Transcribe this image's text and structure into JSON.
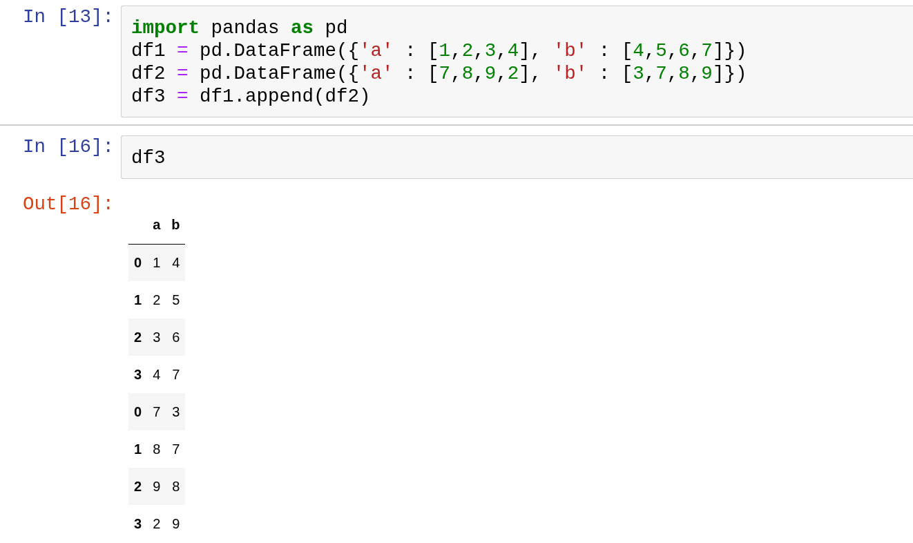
{
  "cells": [
    {
      "prompt": "In [13]:",
      "lines": [
        [
          {
            "text": "import",
            "kind": "keyword"
          },
          {
            "text": " pandas ",
            "kind": "plain"
          },
          {
            "text": "as",
            "kind": "keyword"
          },
          {
            "text": " pd",
            "kind": "plain"
          }
        ],
        [
          {
            "text": "df1 ",
            "kind": "plain"
          },
          {
            "text": "=",
            "kind": "operator"
          },
          {
            "text": " pd.DataFrame({",
            "kind": "plain"
          },
          {
            "text": "'a'",
            "kind": "string"
          },
          {
            "text": " : [",
            "kind": "plain"
          },
          {
            "text": "1",
            "kind": "number"
          },
          {
            "text": ",",
            "kind": "plain"
          },
          {
            "text": "2",
            "kind": "number"
          },
          {
            "text": ",",
            "kind": "plain"
          },
          {
            "text": "3",
            "kind": "number"
          },
          {
            "text": ",",
            "kind": "plain"
          },
          {
            "text": "4",
            "kind": "number"
          },
          {
            "text": "], ",
            "kind": "plain"
          },
          {
            "text": "'b'",
            "kind": "string"
          },
          {
            "text": " : [",
            "kind": "plain"
          },
          {
            "text": "4",
            "kind": "number"
          },
          {
            "text": ",",
            "kind": "plain"
          },
          {
            "text": "5",
            "kind": "number"
          },
          {
            "text": ",",
            "kind": "plain"
          },
          {
            "text": "6",
            "kind": "number"
          },
          {
            "text": ",",
            "kind": "plain"
          },
          {
            "text": "7",
            "kind": "number"
          },
          {
            "text": "]})",
            "kind": "plain"
          }
        ],
        [
          {
            "text": "df2 ",
            "kind": "plain"
          },
          {
            "text": "=",
            "kind": "operator"
          },
          {
            "text": " pd.DataFrame({",
            "kind": "plain"
          },
          {
            "text": "'a'",
            "kind": "string"
          },
          {
            "text": " : [",
            "kind": "plain"
          },
          {
            "text": "7",
            "kind": "number"
          },
          {
            "text": ",",
            "kind": "plain"
          },
          {
            "text": "8",
            "kind": "number"
          },
          {
            "text": ",",
            "kind": "plain"
          },
          {
            "text": "9",
            "kind": "number"
          },
          {
            "text": ",",
            "kind": "plain"
          },
          {
            "text": "2",
            "kind": "number"
          },
          {
            "text": "], ",
            "kind": "plain"
          },
          {
            "text": "'b'",
            "kind": "string"
          },
          {
            "text": " : [",
            "kind": "plain"
          },
          {
            "text": "3",
            "kind": "number"
          },
          {
            "text": ",",
            "kind": "plain"
          },
          {
            "text": "7",
            "kind": "number"
          },
          {
            "text": ",",
            "kind": "plain"
          },
          {
            "text": "8",
            "kind": "number"
          },
          {
            "text": ",",
            "kind": "plain"
          },
          {
            "text": "9",
            "kind": "number"
          },
          {
            "text": "]})",
            "kind": "plain"
          }
        ],
        [
          {
            "text": "df3 ",
            "kind": "plain"
          },
          {
            "text": "=",
            "kind": "operator"
          },
          {
            "text": " df1.append(df2)",
            "kind": "plain"
          }
        ]
      ]
    },
    {
      "prompt": "In [16]:",
      "lines": [
        [
          {
            "text": "df3",
            "kind": "plain"
          }
        ]
      ],
      "output": {
        "prompt": "Out[16]:",
        "table": {
          "columns": [
            "a",
            "b"
          ],
          "rows": [
            {
              "index": "0",
              "cells": [
                "1",
                "4"
              ]
            },
            {
              "index": "1",
              "cells": [
                "2",
                "5"
              ]
            },
            {
              "index": "2",
              "cells": [
                "3",
                "6"
              ]
            },
            {
              "index": "3",
              "cells": [
                "4",
                "7"
              ]
            },
            {
              "index": "0",
              "cells": [
                "7",
                "3"
              ]
            },
            {
              "index": "1",
              "cells": [
                "8",
                "7"
              ]
            },
            {
              "index": "2",
              "cells": [
                "9",
                "8"
              ]
            },
            {
              "index": "3",
              "cells": [
                "2",
                "9"
              ]
            }
          ]
        }
      }
    }
  ]
}
